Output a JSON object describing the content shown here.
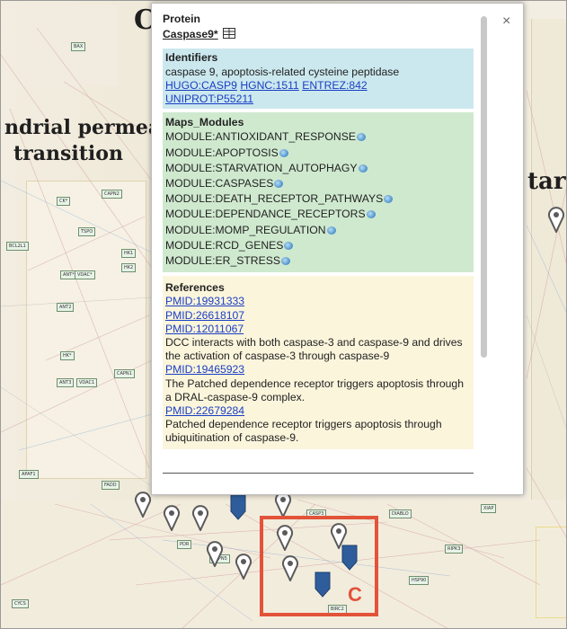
{
  "map": {
    "title_fragment": "C",
    "heading_left_line1": "ndrial permeal",
    "heading_left_line2": "transition",
    "heading_right": "tary",
    "nodes": [
      "ANT*",
      "VDAC*",
      "CK*",
      "HK*",
      "TSPO",
      "CAPN1",
      "BAX",
      "ANT2",
      "ANT3",
      "VDAC1",
      "HK1",
      "HK2",
      "CAPN2",
      "APAF1",
      "FADD",
      "CASP3",
      "DIABLO",
      "BIRC2",
      "CAPN5",
      "PDR",
      "HSP90",
      "RIPK3",
      "XIAP",
      "CYCS",
      "BCL2L1"
    ]
  },
  "popup": {
    "type_label": "Protein",
    "protein_name": "Caspase9*",
    "close_symbol": "×",
    "identifiers": {
      "heading": "Identifiers",
      "description": "caspase 9, apoptosis-related cysteine peptidase",
      "links": [
        "HUGO:CASP9",
        "HGNC:1511",
        "ENTREZ:842",
        "UNIPROT:P55211"
      ]
    },
    "maps_modules": {
      "heading": "Maps_Modules",
      "modules": [
        "MODULE:ANTIOXIDANT_RESPONSE",
        "MODULE:APOPTOSIS",
        "MODULE:STARVATION_AUTOPHAGY",
        "MODULE:CASPASES",
        "MODULE:DEATH_RECEPTOR_PATHWAYS",
        "MODULE:DEPENDANCE_RECEPTORS",
        "MODULE:MOMP_REGULATION",
        "MODULE:RCD_GENES",
        "MODULE:ER_STRESS"
      ]
    },
    "references": {
      "heading": "References",
      "pmid1": "PMID:19931333",
      "pmid2": "PMID:26618107",
      "pmid3": "PMID:12011067",
      "note3": "DCC interacts with both caspase-3 and caspase-9 and drives the activation of caspase-3 through caspase-9",
      "pmid4": "PMID:19465923",
      "note4": "The Patched dependence receptor triggers apoptosis through a DRAL-caspase-9 complex.",
      "pmid5": "PMID:22679284",
      "note5": "Patched dependence receptor triggers apoptosis through ubiquitination of caspase-9."
    }
  },
  "highlight": {
    "letter": "C",
    "color": "#e2533a"
  },
  "colors": {
    "identifiers_bg": "#cbe8ee",
    "maps_bg": "#cfe9cf",
    "refs_bg": "#fbf5dc",
    "link": "#1a3ec4",
    "marker_grey": "#5a5a5a",
    "marker_blue": "#2f5d9c"
  }
}
